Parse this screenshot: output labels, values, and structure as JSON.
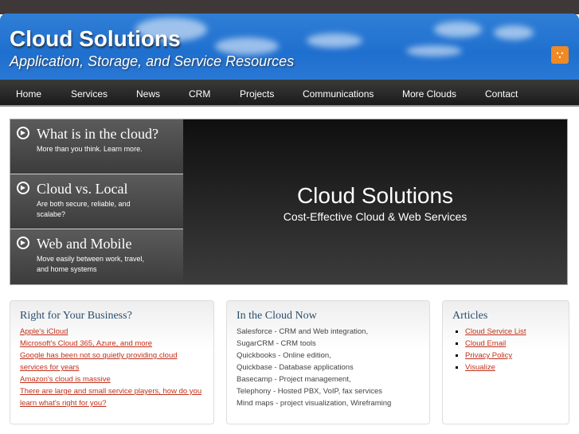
{
  "header": {
    "title": "Cloud Solutions",
    "subtitle": "Application, Storage, and Service Resources",
    "rss_icon": "rss-icon"
  },
  "nav": [
    "Home",
    "Services",
    "News",
    "CRM",
    "Projects",
    "Communications",
    "More Clouds",
    "Contact"
  ],
  "hero": {
    "tabs": [
      {
        "title": "What is in the cloud?",
        "desc": "More than you think. Learn more."
      },
      {
        "title": "Cloud vs. Local",
        "desc": "Are both secure, reliable, and scalabe?"
      },
      {
        "title": "Web and Mobile",
        "desc": "Move easily between work, travel, and home systems"
      }
    ],
    "title": "Cloud Solutions",
    "subtitle": "Cost-Effective Cloud & Web Services"
  },
  "business": {
    "heading": "Right for Your Business?",
    "links": [
      "Apple's iCloud",
      "Microsoft's Cloud 365, Azure, and more",
      "Google has been not so quietly providing cloud services for years",
      "Amazon's cloud is massive",
      "There are large and small service players, how do you learn what's right for you?"
    ]
  },
  "now": {
    "heading": "In the Cloud Now",
    "items": [
      "Salesforce - CRM and Web integration,",
      "SugarCRM - CRM tools",
      "Quickbooks - Online edition,",
      "Quickbase - Database applications",
      "Basecamp - Project management,",
      "Telephony - Hosted PBX, VoIP, fax services",
      "Mind maps - project visualization, Wireframing"
    ]
  },
  "articles": {
    "heading": "Articles",
    "links": [
      "Cloud Service List",
      "Cloud Email",
      "Privacy Policy",
      "Visualize"
    ]
  }
}
